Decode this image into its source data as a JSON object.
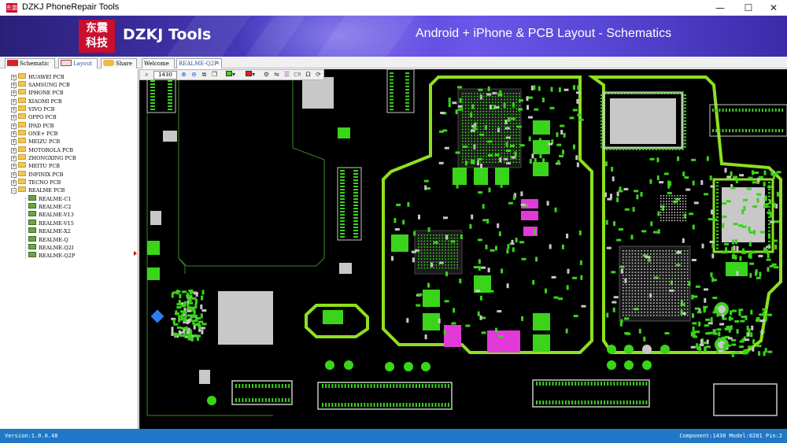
{
  "window": {
    "title": "DZKJ PhoneRepair Tools",
    "minimize": "—",
    "maximize": "☐",
    "close": "✕",
    "app_icon_text": "东震"
  },
  "banner": {
    "logo_text_top": "东震",
    "logo_text_bottom": "科技",
    "brand": "DZKJ Tools",
    "tagline": "Android + iPhone & PCB Layout - Schematics"
  },
  "tabs": [
    {
      "label": "Schematic",
      "icon": "pdf-icon"
    },
    {
      "label": "Layout",
      "icon": "pads-icon"
    },
    {
      "label": "Share",
      "icon": "share-icon"
    },
    {
      "label": "Welcome"
    },
    {
      "label": "REALME-Q2P",
      "close": "✕"
    }
  ],
  "tree": {
    "collapsed_symbol": "+",
    "expanded_symbol": "−",
    "items": [
      {
        "label": "HUAWEI PCB",
        "expanded": false
      },
      {
        "label": "SAMSUNG PCB",
        "expanded": false
      },
      {
        "label": "IPHONE PCB",
        "expanded": false
      },
      {
        "label": "XIAOMI PCB",
        "expanded": false
      },
      {
        "label": "VIVO PCB",
        "expanded": false
      },
      {
        "label": "OPPO PCB",
        "expanded": false
      },
      {
        "label": "IPAD PCB",
        "expanded": false
      },
      {
        "label": "ONE+ PCB",
        "expanded": false
      },
      {
        "label": "MEIZU PCB",
        "expanded": false
      },
      {
        "label": "MOTOROLA PCB",
        "expanded": false
      },
      {
        "label": "ZHONGXING PCB",
        "expanded": false
      },
      {
        "label": "MEITU PCB",
        "expanded": false
      },
      {
        "label": "INFINIX PCB",
        "expanded": false
      },
      {
        "label": "TECNO PCB",
        "expanded": false
      },
      {
        "label": "REALME PCB",
        "expanded": true
      }
    ],
    "children": [
      "REALME-C1",
      "REALME-C2",
      "REALME-V13",
      "REALME-V15",
      "REALME-X2",
      "REALME-Q",
      "REALME-Q2I",
      "REALME-Q2P"
    ]
  },
  "toolbar": {
    "zoom_value": "1430",
    "search_icon": "magnifier-icon",
    "buttons": [
      "zoom-in-icon",
      "zoom-out-icon",
      "fit-icon",
      "copy-icon",
      "layer-green-select",
      "layer-red-select",
      "settings-icon",
      "mirror-icon",
      "list-icon",
      "cr-label",
      "omega-label",
      "refresh-icon"
    ],
    "cr_label": "CR",
    "omega_label": "Ω"
  },
  "status": {
    "version": "Version:1.0.0.48",
    "info": "Component:1430 Model:0201 Pin:2"
  },
  "colors": {
    "board_outline": "#8fe01f",
    "pad_green": "#3ad41a",
    "component_gray": "#c8c8c8",
    "highlight_magenta": "#e23ad8",
    "status_bar": "#1f77c6",
    "banner_purple": "#4a3cc4"
  }
}
